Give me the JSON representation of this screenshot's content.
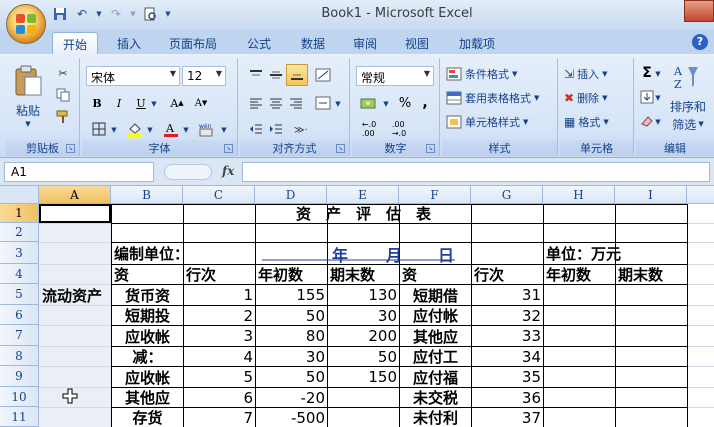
{
  "window": {
    "title": "Book1 - Microsoft Excel"
  },
  "ribbon_tabs": [
    "开始",
    "插入",
    "页面布局",
    "公式",
    "数据",
    "审阅",
    "视图",
    "加载项"
  ],
  "clipboard": {
    "paste": "粘贴",
    "label": "剪贴板"
  },
  "font": {
    "name": "宋体",
    "size": "12",
    "label": "字体"
  },
  "alignment": {
    "label": "对齐方式"
  },
  "number": {
    "format": "常规",
    "percent": "%",
    "comma": ",",
    "label": "数字"
  },
  "styles": {
    "conditional": "条件格式",
    "table": "套用表格格式",
    "cell": "单元格样式",
    "label": "样式"
  },
  "cells_group": {
    "insert": "插入",
    "delete": "删除",
    "format": "格式",
    "label": "单元格"
  },
  "editing": {
    "sort": "排序和",
    "filter": "筛选",
    "label": "编辑",
    "sigma": "Σ"
  },
  "formula_bar": {
    "name_box": "A1",
    "fx": "fx"
  },
  "columns": [
    "A",
    "B",
    "C",
    "D",
    "E",
    "F",
    "G",
    "H",
    "I"
  ],
  "rows": [
    "1",
    "2",
    "3",
    "4",
    "5",
    "6",
    "7",
    "8",
    "9",
    "10",
    "11"
  ],
  "sheet": {
    "title": "资　产　评　估　表",
    "unit_label": "编制单位：",
    "date": {
      "year": "年",
      "month": "月",
      "day": "日"
    },
    "unit_right": "单位：万元",
    "headers": [
      "资",
      "行次",
      "年初数",
      "期末数",
      "资",
      "行次",
      "年初数",
      "期末数"
    ],
    "current_assets": "流动资产",
    "left_rows": [
      {
        "name": "货币资",
        "line": "1",
        "begin": "155",
        "end": "130"
      },
      {
        "name": "短期投",
        "line": "2",
        "begin": "50",
        "end": "30"
      },
      {
        "name": "应收帐",
        "line": "3",
        "begin": "80",
        "end": "200"
      },
      {
        "name": "减：",
        "line": "4",
        "begin": "30",
        "end": "50"
      },
      {
        "name": "应收帐",
        "line": "5",
        "begin": "50",
        "end": "150"
      },
      {
        "name": "其他应",
        "line": "6",
        "begin": "-20",
        "end": ""
      },
      {
        "name": "存货",
        "line": "7",
        "begin": "-500",
        "end": ""
      }
    ],
    "right_rows": [
      {
        "name": "短期借",
        "line": "31"
      },
      {
        "name": "应付帐",
        "line": "32"
      },
      {
        "name": "其他应",
        "line": "33"
      },
      {
        "name": "应付工",
        "line": "34"
      },
      {
        "name": "应付福",
        "line": "35"
      },
      {
        "name": "未交税",
        "line": "36"
      },
      {
        "name": "未付利",
        "line": "37"
      }
    ]
  },
  "colors": {
    "accent": "#15428b",
    "date_blue": "#1f3f9e"
  }
}
